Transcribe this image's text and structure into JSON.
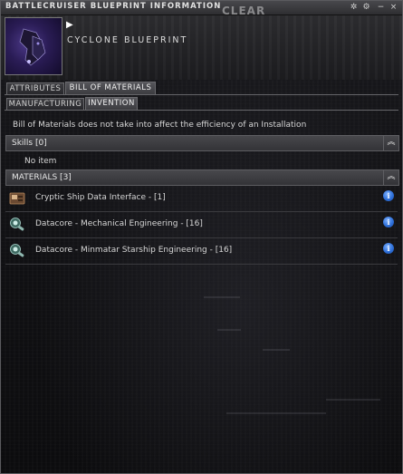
{
  "window": {
    "title": "BATTLECRUISER BLUEPRINT INFORMATION",
    "clear_label": "CLEAR",
    "buttons": {
      "minimize": "−",
      "close": "×",
      "pin": "✲",
      "settings": "⚙"
    }
  },
  "item": {
    "name": "CYCLONE BLUEPRINT"
  },
  "tabs": {
    "row1": [
      {
        "label": "ATTRIBUTES",
        "active": false
      },
      {
        "label": "BILL OF MATERIALS",
        "active": true
      }
    ],
    "row2": [
      {
        "label": "MANUFACTURING",
        "active": false
      },
      {
        "label": "INVENTION",
        "active": true
      }
    ]
  },
  "note": "Bill of Materials does not take into affect the efficiency of an Installation",
  "skills": {
    "header": "Skills [0]",
    "empty_text": "No item"
  },
  "materials": {
    "header": "MATERIALS [3]",
    "items": [
      {
        "label": "Cryptic Ship Data Interface - [1]",
        "icon": "data-interface-icon"
      },
      {
        "label": "Datacore - Mechanical Engineering - [16]",
        "icon": "datacore-icon"
      },
      {
        "label": "Datacore - Minmatar Starship Engineering - [16]",
        "icon": "datacore-icon"
      }
    ]
  },
  "colors": {
    "info_icon": "#2e6fd8",
    "panel": "#121215"
  }
}
